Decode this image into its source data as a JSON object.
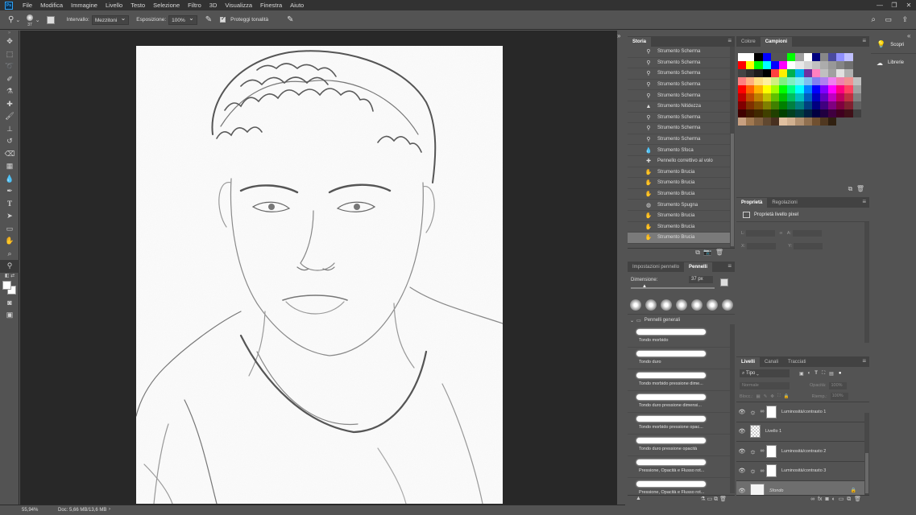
{
  "menu": {
    "logo": "Ps",
    "items": [
      "File",
      "Modifica",
      "Immagine",
      "Livello",
      "Testo",
      "Selezione",
      "Filtro",
      "3D",
      "Visualizza",
      "Finestra",
      "Aiuto"
    ]
  },
  "options": {
    "brush_size": "37",
    "range_label": "Intervallo:",
    "range_value": "Mezzitoni",
    "exposure_label": "Esposizione:",
    "exposure_value": "100%",
    "protect_label": "Proteggi tonalità"
  },
  "history": {
    "tabs": [
      "Storia"
    ],
    "items": [
      {
        "label": "Strumento Scherma",
        "icon": "dodge-icon"
      },
      {
        "label": "Strumento Scherma",
        "icon": "dodge-icon"
      },
      {
        "label": "Strumento Scherma",
        "icon": "dodge-icon"
      },
      {
        "label": "Strumento Scherma",
        "icon": "dodge-icon"
      },
      {
        "label": "Strumento Scherma",
        "icon": "dodge-icon"
      },
      {
        "label": "Strumento Nitidezza",
        "icon": "sharpen-icon"
      },
      {
        "label": "Strumento Scherma",
        "icon": "dodge-icon"
      },
      {
        "label": "Strumento Scherma",
        "icon": "dodge-icon"
      },
      {
        "label": "Strumento Scherma",
        "icon": "dodge-icon"
      },
      {
        "label": "Strumento Sfoca",
        "icon": "blur-icon"
      },
      {
        "label": "Pennello correttivo al volo",
        "icon": "bandage-icon"
      },
      {
        "label": "Strumento Brucia",
        "icon": "burn-icon"
      },
      {
        "label": "Strumento Brucia",
        "icon": "burn-icon"
      },
      {
        "label": "Strumento Brucia",
        "icon": "burn-icon"
      },
      {
        "label": "Strumento Spugna",
        "icon": "sponge-icon"
      },
      {
        "label": "Strumento Brucia",
        "icon": "burn-icon"
      },
      {
        "label": "Strumento Brucia",
        "icon": "burn-icon"
      },
      {
        "label": "Strumento Brucia",
        "icon": "burn-icon"
      }
    ]
  },
  "swatches": {
    "tabs": [
      "Colore",
      "Campioni"
    ],
    "colors": [
      "#ffffff",
      "#ffffff",
      "#000000",
      "#0000ff",
      "#555555",
      "#555555",
      "#00ff00",
      "#a0a0a0",
      "#ffffff",
      "#00007f",
      "#888888",
      "#4a4a9f",
      "#9090ff",
      "#c0c0ff",
      "#535353",
      "#535353",
      "#ff0000",
      "#ffff00",
      "#00ff00",
      "#00ffff",
      "#0000ff",
      "#ff00ff",
      "#ffffff",
      "#e8e8e8",
      "#d4d4d4",
      "#c0c0c0",
      "#acacac",
      "#989898",
      "#848484",
      "#707070",
      "#535353",
      "#535353",
      "#444444",
      "#303030",
      "#1c1c1c",
      "#000000",
      "#ff4040",
      "#fff000",
      "#00b050",
      "#00b0f0",
      "#7030a0",
      "#ff80c0",
      "#c0c0c0",
      "#a0a0a0",
      "#e0e0e0",
      "#b0b0b0",
      "#535353",
      "#535353",
      "#ff8080",
      "#ffb080",
      "#ffe080",
      "#fff0a0",
      "#d0f080",
      "#80f080",
      "#80f0c0",
      "#80f0f0",
      "#80c0f0",
      "#8080f0",
      "#b080f0",
      "#f080f0",
      "#f080b0",
      "#f09090",
      "#c0c0c0",
      "#535353",
      "#ff0000",
      "#ff6000",
      "#ffb000",
      "#ffff00",
      "#a0ff00",
      "#00ff00",
      "#00ff80",
      "#00ffff",
      "#0080ff",
      "#0000ff",
      "#8000ff",
      "#ff00ff",
      "#ff0080",
      "#ff4060",
      "#a0a0a0",
      "#535353",
      "#c00000",
      "#c04800",
      "#c08000",
      "#c0c000",
      "#60c000",
      "#00c000",
      "#00c060",
      "#00c0c0",
      "#0060c0",
      "#0000c0",
      "#6000c0",
      "#c000c0",
      "#c00060",
      "#c03040",
      "#808080",
      "#535353",
      "#800000",
      "#803000",
      "#805000",
      "#808000",
      "#408000",
      "#008000",
      "#008040",
      "#008080",
      "#004080",
      "#000080",
      "#400080",
      "#800080",
      "#800040",
      "#802030",
      "#606060",
      "#535353",
      "#400000",
      "#401800",
      "#402800",
      "#404000",
      "#204000",
      "#004000",
      "#004020",
      "#004040",
      "#002040",
      "#000040",
      "#200040",
      "#400040",
      "#400020",
      "#401018",
      "#404040",
      "#535353",
      "#c8a080",
      "#a07850",
      "#806040",
      "#604830",
      "#483020",
      "#e0c0a0",
      "#d0b090",
      "#b09070",
      "#907050",
      "#705030",
      "#503820",
      "#302010",
      "#535353",
      "#535353",
      "#535353",
      "#535353"
    ]
  },
  "properties": {
    "tabs": [
      "Proprietà",
      "Regolazioni"
    ],
    "title": "Proprietà livello pixel",
    "fields": [
      "L:",
      "A:",
      "X:",
      "Y:"
    ]
  },
  "brushes": {
    "tabs": [
      "Impostazioni pennello",
      "Pennelli"
    ],
    "size_label": "Dimensione:",
    "size_value": "37 px",
    "group": "Pennelli generali",
    "items": [
      "Tondo morbido",
      "Tondo duro",
      "Tondo morbido pressione dime...",
      "Tondo duro pressione dimensi...",
      "Tondo morbido pressione opac...",
      "Tondo duro pressione opacità",
      "Pressione, Opacità e Flusso rot...",
      "Pressione, Opacità e Flusso rot..."
    ]
  },
  "layers": {
    "tabs": [
      "Livelli",
      "Canali",
      "Tracciati"
    ],
    "filter": "Tipo",
    "blend": "Normale",
    "opacity_label": "Opacità:",
    "opacity_value": "100%",
    "lock_label": "Blocc.:",
    "fill_label": "Riemp.:",
    "fill_value": "100%",
    "items": [
      {
        "name": "Luminosità/contrasto 1",
        "adj": true
      },
      {
        "name": "Livello 1",
        "adj": false
      },
      {
        "name": "Luminosità/contrasto 2",
        "adj": true
      },
      {
        "name": "Luminosità/contrasto 3",
        "adj": true
      },
      {
        "name": "Sfondo",
        "adj": false
      }
    ]
  },
  "right_dock": {
    "items": [
      "Scopri",
      "Librerie"
    ]
  },
  "status": {
    "zoom": "55,94%",
    "doc": "Doc: 5,66 MB/13,6 MB"
  }
}
